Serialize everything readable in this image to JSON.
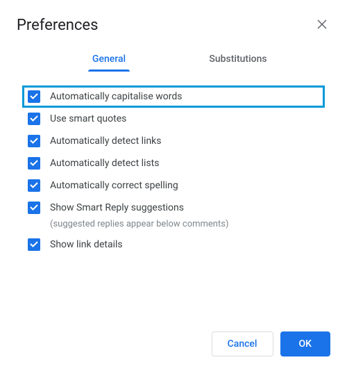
{
  "dialog": {
    "title": "Preferences",
    "tabs": {
      "general": "General",
      "substitutions": "Substitutions"
    },
    "options": [
      {
        "label": "Automatically capitalise words",
        "checked": true,
        "highlighted": true
      },
      {
        "label": "Use smart quotes",
        "checked": true
      },
      {
        "label": "Automatically detect links",
        "checked": true
      },
      {
        "label": "Automatically detect lists",
        "checked": true
      },
      {
        "label": "Automatically correct spelling",
        "checked": true
      },
      {
        "label": "Show Smart Reply suggestions",
        "checked": true,
        "helper": "(suggested replies appear below comments)"
      },
      {
        "label": "Show link details",
        "checked": true
      }
    ],
    "buttons": {
      "cancel": "Cancel",
      "ok": "OK"
    }
  }
}
